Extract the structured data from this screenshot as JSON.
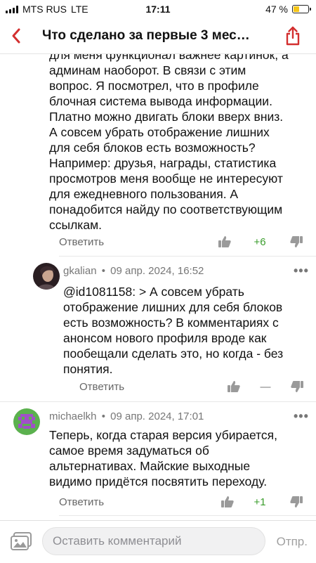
{
  "status_bar": {
    "carrier": "MTS RUS",
    "network": "LTE",
    "time": "17:11",
    "battery_text": "47 %",
    "battery_level": 0.47
  },
  "header": {
    "title": "Что сделано за первые 3 мес…",
    "back_icon": "chevron-left-icon",
    "share_icon": "share-icon",
    "accent_color": "#d32f2f"
  },
  "comments": [
    {
      "text": "для меня функционал важнее картинок, а админам наоборот. В связи с этим вопрос. Я посмотрел, что в профиле блочная система вывода информации. Платно можно двигать блоки вверх вниз. А совсем убрать отображение лишних для себя блоков есть возможность? Например: друзья, награды, статистика просмотров меня вообще не интересуют для ежедневного пользования. А понадобится найду по соответствующим ссылкам.",
      "reply_label": "Ответить",
      "score": "+6"
    },
    {
      "author": "gkalian",
      "date": "09 апр. 2024, 16:52",
      "text": "@id1081158: > А совсем убрать отображение лишних для себя блоков есть возможность? В комментариях с анонсом нового профиля вроде как пообещали сделать это, но когда - без понятия.",
      "reply_label": "Ответить",
      "score": "—"
    },
    {
      "author": "michaelkh",
      "date": "09 апр. 2024, 17:01",
      "text": "Теперь, когда старая версия убирается, самое время задуматься об альтернативах. Майские выходные видимо придётся посвятить переходу.",
      "reply_label": "Ответить",
      "score": "+1"
    }
  ],
  "separator": "•",
  "more_label": "•••",
  "composer": {
    "placeholder": "Оставить комментарий",
    "send_label": "Отпр."
  }
}
